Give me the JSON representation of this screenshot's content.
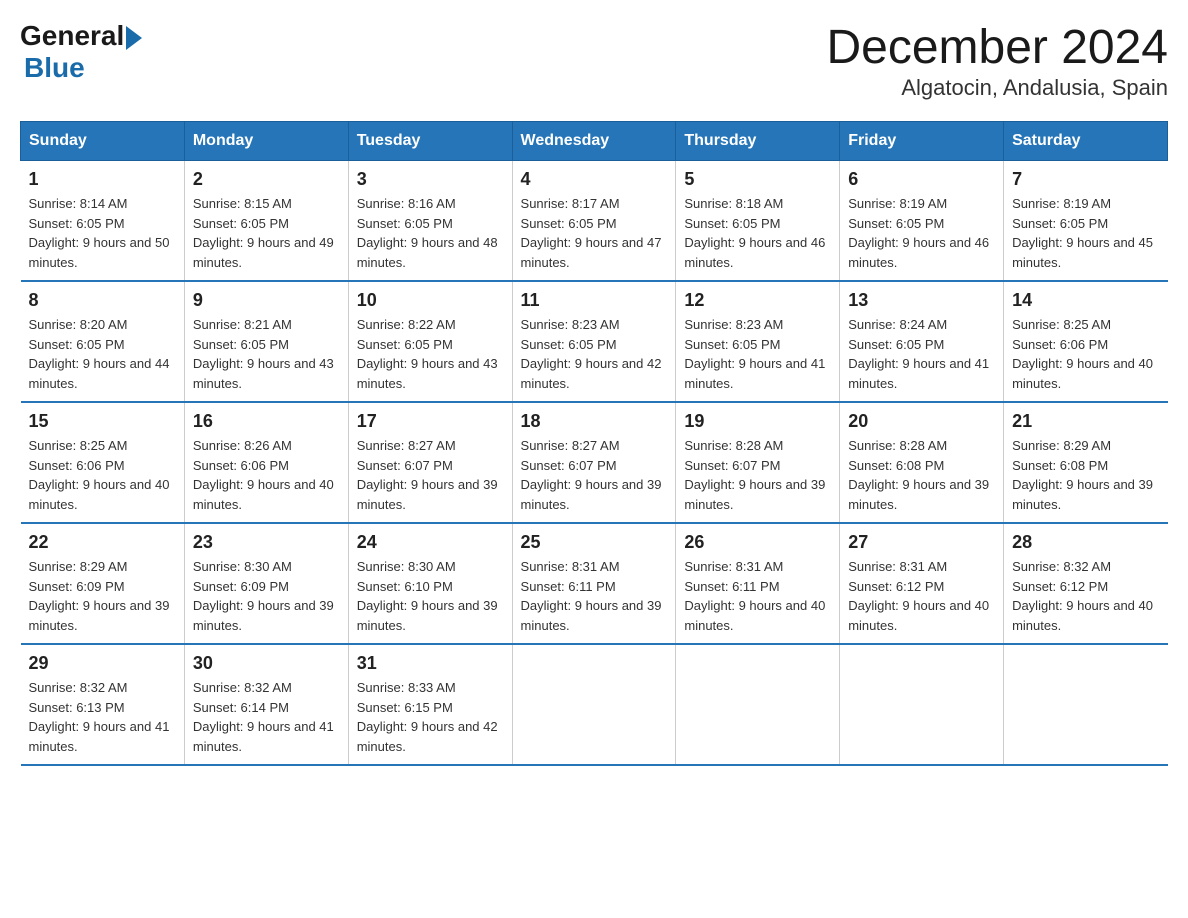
{
  "header": {
    "logo_general": "General",
    "logo_blue": "Blue",
    "month_title": "December 2024",
    "location": "Algatocin, Andalusia, Spain"
  },
  "weekdays": [
    "Sunday",
    "Monday",
    "Tuesday",
    "Wednesday",
    "Thursday",
    "Friday",
    "Saturday"
  ],
  "weeks": [
    [
      {
        "day": "1",
        "sunrise": "8:14 AM",
        "sunset": "6:05 PM",
        "daylight": "9 hours and 50 minutes."
      },
      {
        "day": "2",
        "sunrise": "8:15 AM",
        "sunset": "6:05 PM",
        "daylight": "9 hours and 49 minutes."
      },
      {
        "day": "3",
        "sunrise": "8:16 AM",
        "sunset": "6:05 PM",
        "daylight": "9 hours and 48 minutes."
      },
      {
        "day": "4",
        "sunrise": "8:17 AM",
        "sunset": "6:05 PM",
        "daylight": "9 hours and 47 minutes."
      },
      {
        "day": "5",
        "sunrise": "8:18 AM",
        "sunset": "6:05 PM",
        "daylight": "9 hours and 46 minutes."
      },
      {
        "day": "6",
        "sunrise": "8:19 AM",
        "sunset": "6:05 PM",
        "daylight": "9 hours and 46 minutes."
      },
      {
        "day": "7",
        "sunrise": "8:19 AM",
        "sunset": "6:05 PM",
        "daylight": "9 hours and 45 minutes."
      }
    ],
    [
      {
        "day": "8",
        "sunrise": "8:20 AM",
        "sunset": "6:05 PM",
        "daylight": "9 hours and 44 minutes."
      },
      {
        "day": "9",
        "sunrise": "8:21 AM",
        "sunset": "6:05 PM",
        "daylight": "9 hours and 43 minutes."
      },
      {
        "day": "10",
        "sunrise": "8:22 AM",
        "sunset": "6:05 PM",
        "daylight": "9 hours and 43 minutes."
      },
      {
        "day": "11",
        "sunrise": "8:23 AM",
        "sunset": "6:05 PM",
        "daylight": "9 hours and 42 minutes."
      },
      {
        "day": "12",
        "sunrise": "8:23 AM",
        "sunset": "6:05 PM",
        "daylight": "9 hours and 41 minutes."
      },
      {
        "day": "13",
        "sunrise": "8:24 AM",
        "sunset": "6:05 PM",
        "daylight": "9 hours and 41 minutes."
      },
      {
        "day": "14",
        "sunrise": "8:25 AM",
        "sunset": "6:06 PM",
        "daylight": "9 hours and 40 minutes."
      }
    ],
    [
      {
        "day": "15",
        "sunrise": "8:25 AM",
        "sunset": "6:06 PM",
        "daylight": "9 hours and 40 minutes."
      },
      {
        "day": "16",
        "sunrise": "8:26 AM",
        "sunset": "6:06 PM",
        "daylight": "9 hours and 40 minutes."
      },
      {
        "day": "17",
        "sunrise": "8:27 AM",
        "sunset": "6:07 PM",
        "daylight": "9 hours and 39 minutes."
      },
      {
        "day": "18",
        "sunrise": "8:27 AM",
        "sunset": "6:07 PM",
        "daylight": "9 hours and 39 minutes."
      },
      {
        "day": "19",
        "sunrise": "8:28 AM",
        "sunset": "6:07 PM",
        "daylight": "9 hours and 39 minutes."
      },
      {
        "day": "20",
        "sunrise": "8:28 AM",
        "sunset": "6:08 PM",
        "daylight": "9 hours and 39 minutes."
      },
      {
        "day": "21",
        "sunrise": "8:29 AM",
        "sunset": "6:08 PM",
        "daylight": "9 hours and 39 minutes."
      }
    ],
    [
      {
        "day": "22",
        "sunrise": "8:29 AM",
        "sunset": "6:09 PM",
        "daylight": "9 hours and 39 minutes."
      },
      {
        "day": "23",
        "sunrise": "8:30 AM",
        "sunset": "6:09 PM",
        "daylight": "9 hours and 39 minutes."
      },
      {
        "day": "24",
        "sunrise": "8:30 AM",
        "sunset": "6:10 PM",
        "daylight": "9 hours and 39 minutes."
      },
      {
        "day": "25",
        "sunrise": "8:31 AM",
        "sunset": "6:11 PM",
        "daylight": "9 hours and 39 minutes."
      },
      {
        "day": "26",
        "sunrise": "8:31 AM",
        "sunset": "6:11 PM",
        "daylight": "9 hours and 40 minutes."
      },
      {
        "day": "27",
        "sunrise": "8:31 AM",
        "sunset": "6:12 PM",
        "daylight": "9 hours and 40 minutes."
      },
      {
        "day": "28",
        "sunrise": "8:32 AM",
        "sunset": "6:12 PM",
        "daylight": "9 hours and 40 minutes."
      }
    ],
    [
      {
        "day": "29",
        "sunrise": "8:32 AM",
        "sunset": "6:13 PM",
        "daylight": "9 hours and 41 minutes."
      },
      {
        "day": "30",
        "sunrise": "8:32 AM",
        "sunset": "6:14 PM",
        "daylight": "9 hours and 41 minutes."
      },
      {
        "day": "31",
        "sunrise": "8:33 AM",
        "sunset": "6:15 PM",
        "daylight": "9 hours and 42 minutes."
      },
      null,
      null,
      null,
      null
    ]
  ]
}
